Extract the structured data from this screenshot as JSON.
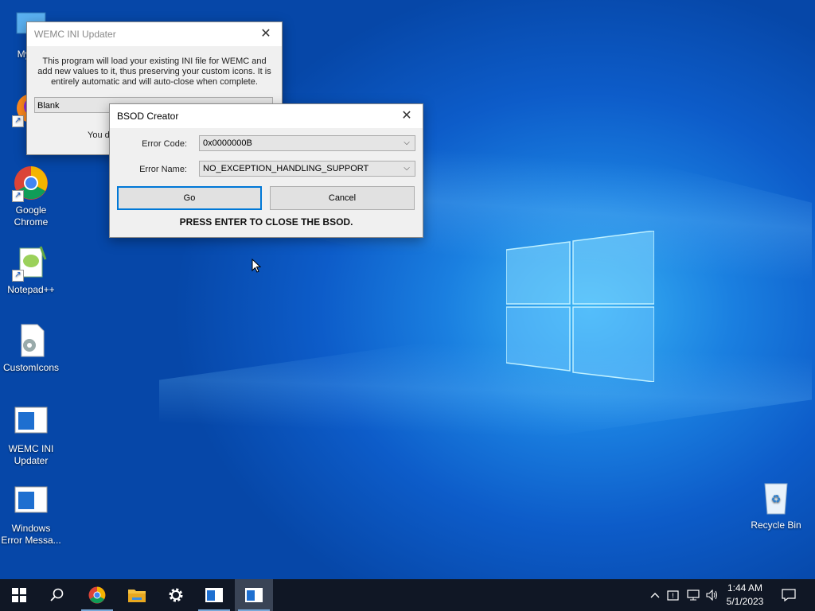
{
  "desktop": {
    "icons": [
      {
        "label": "My Co",
        "name": "my-computer"
      },
      {
        "label": "Fi",
        "name": "firefox"
      },
      {
        "label": "Google Chrome",
        "name": "google-chrome"
      },
      {
        "label": "Notepad++",
        "name": "notepad-plus-plus"
      },
      {
        "label": "CustomIcons",
        "name": "customicons"
      },
      {
        "label": "WEMC INI Updater",
        "name": "wemc-ini-updater"
      },
      {
        "label": "Windows Error Messa...",
        "name": "windows-error-message"
      },
      {
        "label": "Recycle Bin",
        "name": "recycle-bin"
      }
    ]
  },
  "wemc_dialog": {
    "title": "WEMC INI Updater",
    "description": "This program will load your existing INI file for WEMC and add new values to it, thus preserving your custom icons. It is entirely automatic and will auto-close when complete.",
    "combo_value": "Blank",
    "partial_text": "You d"
  },
  "bsod_dialog": {
    "title": "BSOD Creator",
    "error_code_label": "Error Code:",
    "error_code_value": "0x0000000B",
    "error_name_label": "Error Name:",
    "error_name_value": "NO_EXCEPTION_HANDLING_SUPPORT",
    "go_label": "Go",
    "cancel_label": "Cancel",
    "hint": "PRESS ENTER TO CLOSE THE BSOD."
  },
  "taskbar": {
    "items": [
      "start",
      "search",
      "google-chrome",
      "file-explorer",
      "settings",
      "wemc-ini-updater",
      "bsod-creator"
    ],
    "time": "1:44 AM",
    "date": "5/1/2023"
  },
  "colors": {
    "accent": "#0078d7",
    "taskbar": "#101725"
  }
}
